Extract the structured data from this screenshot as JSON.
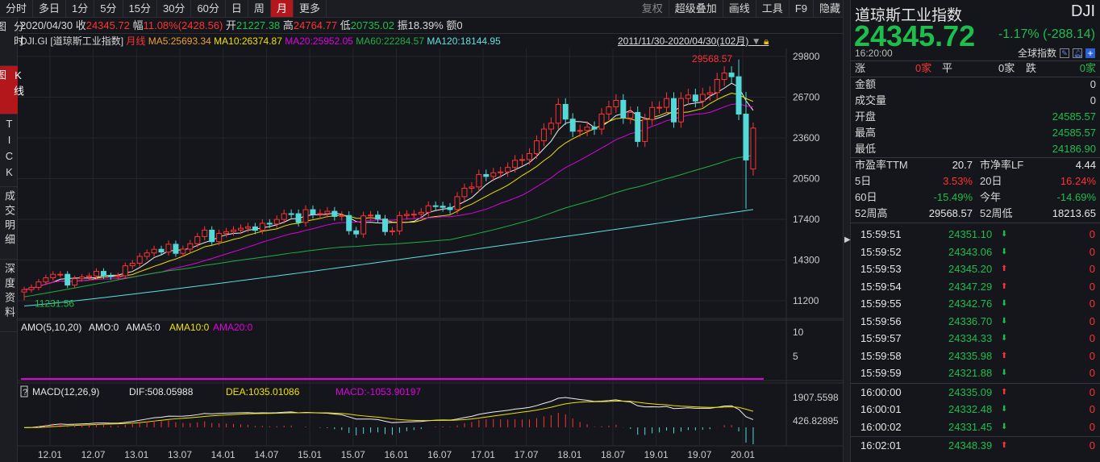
{
  "toolbar": {
    "left": [
      "分时",
      "多日",
      "1分",
      "5分",
      "15分",
      "30分",
      "60分",
      "日",
      "周",
      "月",
      "更多"
    ],
    "active": "月",
    "right": [
      "复权",
      "超级叠加",
      "画线",
      "工具",
      "F9",
      "隐藏"
    ]
  },
  "sidebar": [
    {
      "label": "分时图",
      "active": false
    },
    {
      "label": "K线图",
      "active": true
    },
    {
      "label": "TICK",
      "active": false
    },
    {
      "label": "成交明细",
      "active": false
    },
    {
      "label": "深度资料",
      "active": false
    }
  ],
  "info": {
    "date": "2020/04/30",
    "close_label": "收",
    "close": "24345.72",
    "amp_label": "幅",
    "amp": "11.08%(2428.56)",
    "open_label": "开",
    "open": "21227.38",
    "high_label": "高",
    "high": "24764.77",
    "low_label": "低",
    "low": "20735.02",
    "swing_label": "振",
    "swing": "18.39%",
    "amount_label": "额",
    "amount": "0"
  },
  "legend": {
    "code": "DJI.GI",
    "name": "[道琼斯工业指数]",
    "period": "月线",
    "ma5": "MA5:25693.34",
    "ma10": "MA10:26374.87",
    "ma20": "MA20:25952.05",
    "ma60": "MA60:22284.57",
    "ma120": "MA120:18144.95",
    "range": "2011/11/30-2020/04/30(102月)"
  },
  "colors": {
    "up": "#ff3232",
    "down": "#54d8d8",
    "ma5": "#f0f0f0",
    "ma10": "#f0e000",
    "ma20": "#e000e0",
    "ma60": "#20b040",
    "ma120": "#60e0e0",
    "bg": "#14161b"
  },
  "chart_data": {
    "type": "candlestick",
    "start": "2011-11",
    "period": "month",
    "closes": [
      12046,
      12218,
      12633,
      12952,
      13212,
      13214,
      12393,
      12880,
      13009,
      13091,
      13437,
      13096,
      13026,
      13104,
      13861,
      14054,
      14579,
      14840,
      15116,
      14910,
      15500,
      14810,
      15130,
      15546,
      16086,
      16577,
      15699,
      16322,
      16458,
      16581,
      16717,
      16827,
      16563,
      17098,
      17043,
      17391,
      17828,
      17823,
      17165,
      18133,
      17776,
      17841,
      18011,
      17620,
      17690,
      16528,
      16285,
      17664,
      17720,
      17425,
      16466,
      16517,
      17685,
      17774,
      17787,
      17930,
      18432,
      18401,
      18308,
      18142,
      19124,
      19763,
      19864,
      20812,
      20663,
      20941,
      21009,
      21350,
      21891,
      21948,
      22405,
      23377,
      24272,
      24719,
      26149,
      25029,
      24103,
      24163,
      24416,
      24271,
      25415,
      25965,
      26458,
      25116,
      25538,
      23327,
      24999,
      25916,
      25929,
      26593,
      24815,
      26600,
      26864,
      26403,
      26917,
      27046,
      28051,
      28538,
      28256,
      25409,
      21917,
      24346
    ],
    "last_candle": {
      "open": 21227.38,
      "high": 24764.77,
      "low": 20735.02,
      "close": 24345.72
    },
    "prev_candle": {
      "open": 25409,
      "high": 27102,
      "low": 18213,
      "close": 21917
    },
    "price_ticks": [
      29800,
      26700,
      23600,
      20500,
      17400,
      14300,
      11200
    ],
    "ylim": [
      10500,
      30500
    ],
    "max_label": "29568.57",
    "min_label": "11231.56",
    "date_labels": [
      {
        "label": "12.01",
        "index": 2
      },
      {
        "label": "12.07",
        "index": 8
      },
      {
        "label": "13.01",
        "index": 14
      },
      {
        "label": "13.07",
        "index": 20
      },
      {
        "label": "14.01",
        "index": 26
      },
      {
        "label": "14.07",
        "index": 32
      },
      {
        "label": "15.01",
        "index": 38
      },
      {
        "label": "15.07",
        "index": 44
      },
      {
        "label": "16.01",
        "index": 50
      },
      {
        "label": "16.07",
        "index": 56
      },
      {
        "label": "17.01",
        "index": 62
      },
      {
        "label": "17.07",
        "index": 68
      },
      {
        "label": "18.01",
        "index": 74
      },
      {
        "label": "18.07",
        "index": 80
      },
      {
        "label": "19.01",
        "index": 86
      },
      {
        "label": "19.07",
        "index": 92
      },
      {
        "label": "20.01",
        "index": 98
      }
    ],
    "amo": {
      "title": "AMO(5,10,20)",
      "amo": "AMO:0",
      "ama5": "AMA5:0",
      "ama10": "AMA10:0",
      "ama20": "AMA20:0",
      "ticks": [
        "10",
        "5"
      ]
    },
    "macd": {
      "help": "?",
      "title": "MACD(12,26,9)",
      "dif": "DIF:508.05988",
      "dea": "DEA:1035.01086",
      "macd": "MACD:-1053.90197",
      "ticks": [
        "1907.5598",
        "426.82895"
      ]
    }
  },
  "quote": {
    "name": "道琼斯工业指数",
    "code": "DJI",
    "price": "24345.72",
    "change": "-1.17% (-288.14)",
    "time": "16:20:00",
    "group": "全球指数",
    "breadth": {
      "up_label": "涨",
      "up": "0家",
      "flat_label": "平",
      "flat": "0家",
      "down_label": "跌",
      "down": "0家"
    },
    "stats": [
      {
        "label": "金额",
        "value": "0"
      },
      {
        "label": "成交量",
        "value": "0"
      },
      {
        "label": "开盘",
        "value": "24585.57"
      },
      {
        "label": "最高",
        "value": "24585.57"
      },
      {
        "label": "最低",
        "value": "24186.90"
      }
    ],
    "ratios": [
      {
        "l1": "市盈率TTM",
        "v1": "20.7",
        "c1": "white",
        "l2": "市净率LF",
        "v2": "4.44",
        "c2": "white"
      },
      {
        "l1": "5日",
        "v1": "3.53%",
        "c1": "red",
        "l2": "20日",
        "v2": "16.24%",
        "c2": "red"
      },
      {
        "l1": "60日",
        "v1": "-15.49%",
        "c1": "green",
        "l2": "今年",
        "v2": "-14.69%",
        "c2": "green"
      },
      {
        "l1": "52周高",
        "v1": "29568.57",
        "c1": "white",
        "l2": "52周低",
        "v2": "18213.65",
        "c2": "white"
      }
    ]
  },
  "ticks": [
    {
      "time": "15:59:51",
      "price": "24351.10",
      "dir": "down",
      "vol": "0"
    },
    {
      "time": "15:59:52",
      "price": "24343.06",
      "dir": "down",
      "vol": "0"
    },
    {
      "time": "15:59:53",
      "price": "24345.20",
      "dir": "up",
      "vol": "0"
    },
    {
      "time": "15:59:54",
      "price": "24347.29",
      "dir": "up",
      "vol": "0"
    },
    {
      "time": "15:59:55",
      "price": "24342.76",
      "dir": "down",
      "vol": "0"
    },
    {
      "time": "15:59:56",
      "price": "24336.70",
      "dir": "down",
      "vol": "0"
    },
    {
      "time": "15:59:57",
      "price": "24334.33",
      "dir": "down",
      "vol": "0"
    },
    {
      "time": "15:59:58",
      "price": "24335.98",
      "dir": "up",
      "vol": "0"
    },
    {
      "time": "15:59:59",
      "price": "24321.88",
      "dir": "down",
      "vol": "0"
    },
    {
      "time": "16:00:00",
      "price": "24335.09",
      "dir": "up",
      "vol": "0"
    },
    {
      "time": "16:00:01",
      "price": "24332.48",
      "dir": "down",
      "vol": "0"
    },
    {
      "time": "16:00:02",
      "price": "24331.45",
      "dir": "down",
      "vol": "0"
    },
    {
      "time": "16:02:01",
      "price": "24348.39",
      "dir": "up",
      "vol": "0"
    }
  ]
}
